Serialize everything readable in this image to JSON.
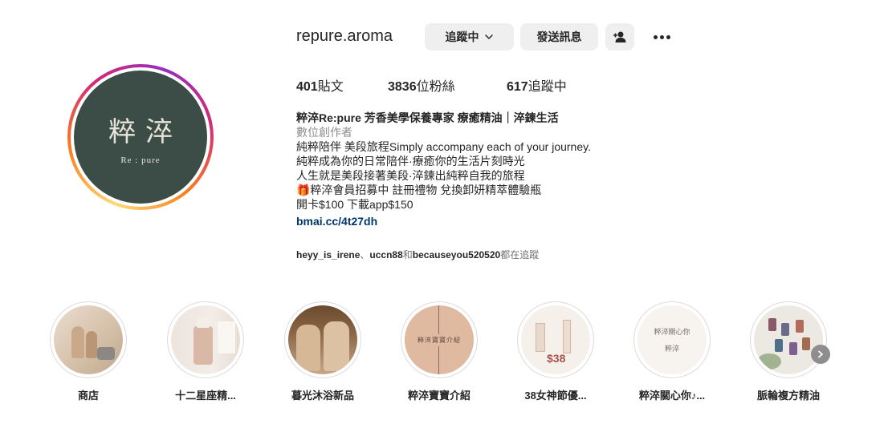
{
  "profile": {
    "username": "repure.aroma",
    "avatar": {
      "logo_cn": "粹淬",
      "logo_en": "Re : pure",
      "bg_color": "#3c4d48"
    }
  },
  "actions": {
    "follow_label": "追蹤中",
    "message_label": "發送訊息",
    "add_user_icon": "add-user-icon",
    "more_icon": "more-options-icon"
  },
  "stats": {
    "posts_count": "401",
    "posts_label": "貼文",
    "followers_count": "3836",
    "followers_label": "位粉絲",
    "following_count": "617",
    "following_label": "追蹤中"
  },
  "bio": {
    "name": "粹淬Re:pure 芳香美學保養專家 療癒精油｜淬鍊生活",
    "category": "數位創作者",
    "lines": [
      "純粹陪伴 美段旅程Simply accompany each of your journey.",
      "純粹成為你的日常陪伴·療癒你的生活片刻時光",
      "人生就是美段接著美段·淬鍊出純粹自我的旅程",
      "🎁粹淬會員招募中 註冊禮物 兌換卸妍精萃體驗瓶",
      "開卡$100 下載app$150"
    ],
    "link": "bmai.cc/4t27dh"
  },
  "followed_by": {
    "user1": "heyy_is_irene",
    "sep": "、",
    "user2": "uccn88",
    "and": "和",
    "user3": "becauseyou520520",
    "suffix": "都在追蹤"
  },
  "highlights": [
    {
      "label": "商店"
    },
    {
      "label": "十二星座精..."
    },
    {
      "label": "暮光沐浴新品"
    },
    {
      "label": "粹淬寶寶介紹",
      "inner_text": "粹淬寶寶介紹"
    },
    {
      "label": "38女神節優...",
      "inner_text": "$38"
    },
    {
      "label": "粹淬關心你♪...",
      "inner_text": "粹淬關心你",
      "inner_sub": "粹淬"
    },
    {
      "label": "脈輪複方精油"
    }
  ]
}
